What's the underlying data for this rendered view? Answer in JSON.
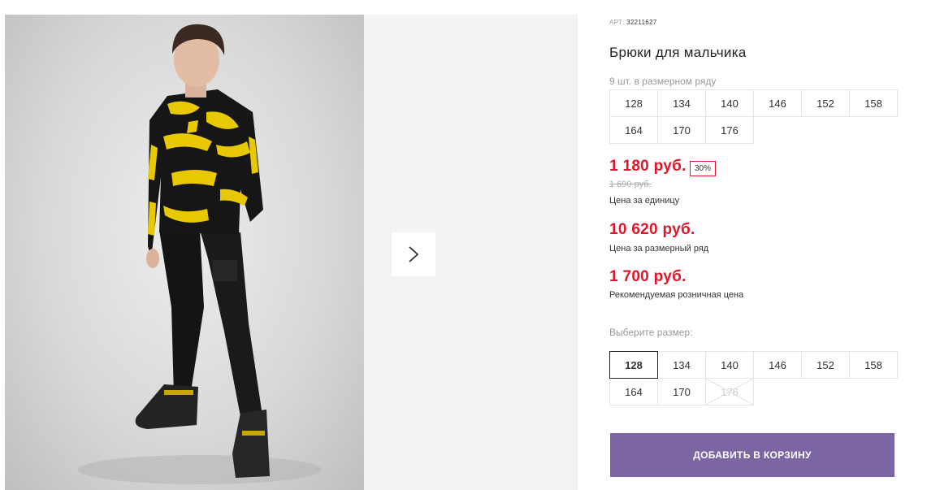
{
  "product": {
    "sku_label": "АРТ:",
    "sku": "32211627",
    "title": "Брюки для мальчика",
    "row_note": "9 шт. в размерном ряду"
  },
  "size_row": [
    "128",
    "134",
    "140",
    "146",
    "152",
    "158",
    "164",
    "170",
    "176"
  ],
  "prices": {
    "unit_price": "1 180 руб.",
    "discount_badge": "30%",
    "old_price": "1 690 руб.",
    "unit_label": "Цена за единицу",
    "row_price": "10 620 руб.",
    "row_label": "Цена за размерный ряд",
    "retail_price": "1 700 руб.",
    "retail_label": "Рекомендуемая розничная цена"
  },
  "size_select": {
    "label": "Выберите размер:",
    "options": [
      "128",
      "134",
      "140",
      "146",
      "152",
      "158",
      "164",
      "170",
      "176"
    ],
    "selected": "128",
    "unavailable": [
      "176"
    ]
  },
  "cart_button": "ДОБАВИТЬ В КОРЗИНУ",
  "icons": {
    "next": "chevron-right-icon",
    "unavailable": "cross-out-icon"
  },
  "colors": {
    "price": "#e0162b",
    "button": "#7b65a3"
  }
}
